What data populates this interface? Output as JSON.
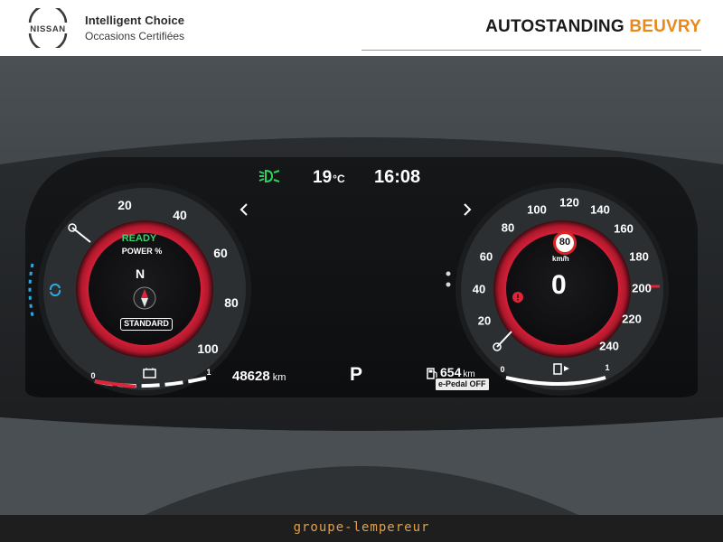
{
  "header": {
    "logo_text": "NISSAN",
    "brand_line1": "Intelligent Choice",
    "brand_line2": "Occasions Certifiées",
    "dealer_part1": "AUTOSTANDING",
    "dealer_part2": "BEUVRY",
    "colors": {
      "accent": "#e8891e",
      "text": "#1a1a1a"
    }
  },
  "cluster": {
    "temperature": "19",
    "temperature_unit": "°C",
    "time": "16:08",
    "status": "READY",
    "power_label": "POWER %",
    "compass": "N",
    "drive_mode": "STANDARD",
    "odometer_value": "48628",
    "odometer_unit": "km",
    "gear": "P",
    "range_value": "654",
    "range_unit": "km",
    "epedal": "e-Pedal OFF",
    "speed_value": "0",
    "speed_unit": "km/h",
    "speed_limit": "80",
    "power_ticks": [
      "20",
      "40",
      "60",
      "80",
      "100"
    ],
    "speed_ticks": [
      "20",
      "40",
      "60",
      "80",
      "100",
      "120",
      "140",
      "160",
      "180",
      "200",
      "220",
      "240"
    ],
    "battery_scale": [
      "0",
      "1"
    ],
    "fuel_scale": [
      "0",
      "1"
    ],
    "icons": [
      "headlight-indicator-icon",
      "eco-icon",
      "compass-icon",
      "battery-charge-icon",
      "fuel-pump-icon",
      "brake-warning-icon",
      "chevron-left-icon",
      "chevron-right-icon"
    ],
    "colors": {
      "gauge_red": "#e0253a",
      "ready_green": "#38d36c",
      "eco_blue": "#2fa8e0",
      "headlight_green": "#2fd25c"
    }
  },
  "footer": {
    "text": "groupe-lempereur",
    "colors": {
      "text": "#e0a04a",
      "background": "#1e1e1e"
    }
  }
}
